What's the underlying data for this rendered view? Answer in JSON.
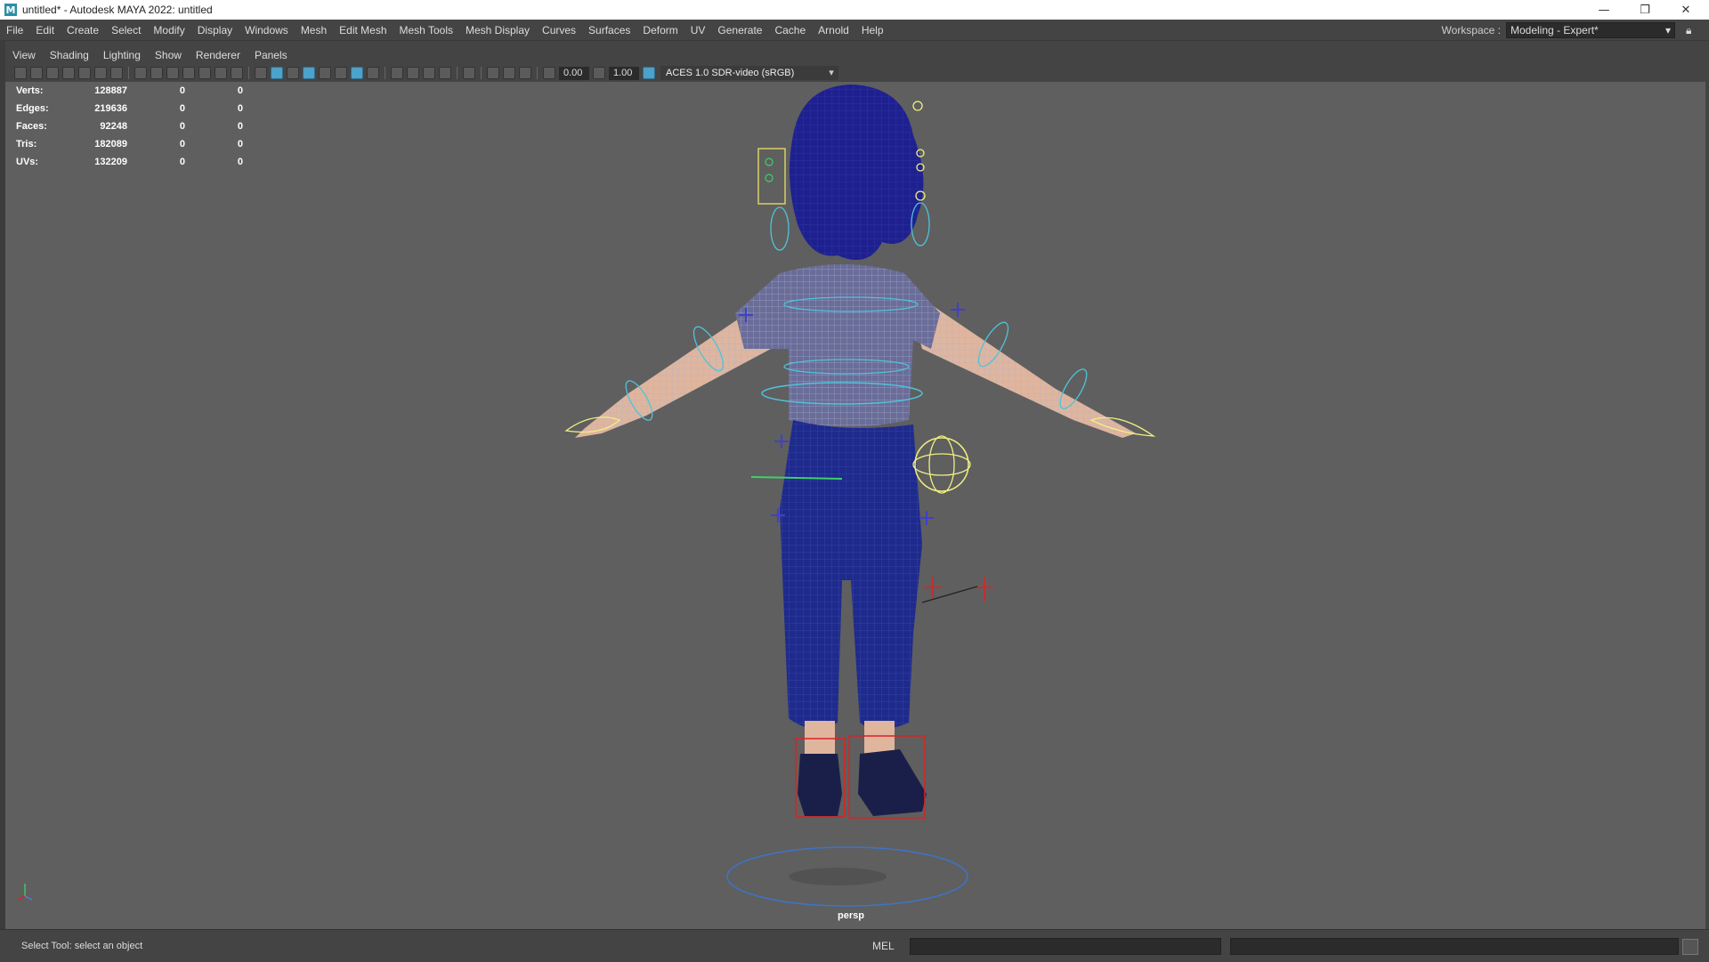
{
  "window": {
    "title": "untitled* - Autodesk MAYA 2022: untitled",
    "app_icon": "M",
    "controls": {
      "minimize": "—",
      "restore": "❐",
      "close": "✕"
    }
  },
  "menus": [
    "File",
    "Edit",
    "Create",
    "Select",
    "Modify",
    "Display",
    "Windows",
    "Mesh",
    "Edit Mesh",
    "Mesh Tools",
    "Mesh Display",
    "Curves",
    "Surfaces",
    "Deform",
    "UV",
    "Generate",
    "Cache",
    "Arnold",
    "Help"
  ],
  "workspace": {
    "label": "Workspace :",
    "value": "Modeling - Expert*"
  },
  "panel_menu": [
    "View",
    "Shading",
    "Lighting",
    "Show",
    "Renderer",
    "Panels"
  ],
  "toolbar": {
    "exposure": "0.00",
    "gamma": "1.00",
    "color_space": "ACES 1.0 SDR-video (sRGB)"
  },
  "hud": [
    {
      "label": "Verts:",
      "v1": "128887",
      "v2": "0",
      "v3": "0"
    },
    {
      "label": "Edges:",
      "v1": "219636",
      "v2": "0",
      "v3": "0"
    },
    {
      "label": "Faces:",
      "v1": "92248",
      "v2": "0",
      "v3": "0"
    },
    {
      "label": "Tris:",
      "v1": "182089",
      "v2": "0",
      "v3": "0"
    },
    {
      "label": "UVs:",
      "v1": "132209",
      "v2": "0",
      "v3": "0"
    }
  ],
  "viewport": {
    "camera": "persp",
    "background": "#5f5f5f",
    "mesh_color": "#1e2a8c",
    "wire_color": "#a9b3c8",
    "control_color": "#4fc3d9",
    "selection_color": "#f0f080"
  },
  "status": {
    "help": "Select Tool: select an object",
    "mel_label": "MEL"
  }
}
